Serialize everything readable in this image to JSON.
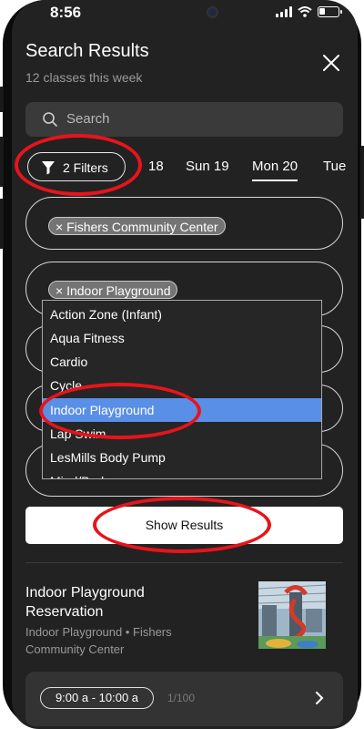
{
  "status_bar": {
    "time": "8:56"
  },
  "header": {
    "title": "Search Results",
    "subtitle": "12 classes this week"
  },
  "search": {
    "placeholder": "Search"
  },
  "filters_button": {
    "label": "2 Filters"
  },
  "dates": [
    {
      "label": "18",
      "active": false
    },
    {
      "label": "Sun 19",
      "active": false
    },
    {
      "label": "Mon 20",
      "active": true
    },
    {
      "label": "Tue",
      "active": false
    }
  ],
  "filters": {
    "location_chip": "× Fishers Community Center",
    "class_chip": "× Indoor Playground"
  },
  "dropdown": {
    "options": [
      "Action Zone (Infant)",
      "Aqua Fitness",
      "Cardio",
      "Cycle",
      "Indoor Playground",
      "Lap Swim",
      "LesMills Body Pump",
      "Mind/Body"
    ],
    "selected": "Indoor Playground"
  },
  "show_results_label": "Show Results",
  "result": {
    "name": "Indoor Playground Reservation",
    "meta": "Indoor Playground • Fishers Community Center",
    "time_slot": "9:00 a - 10:00 a",
    "capacity": "1/100"
  },
  "colors": {
    "annotation": "#e8141b",
    "selected_option": "#5a8fe8",
    "background": "#222222"
  },
  "icons": [
    "search-icon",
    "filter-icon",
    "close-icon",
    "chevron-right-icon",
    "wifi-icon",
    "battery-icon",
    "signal-icon"
  ]
}
